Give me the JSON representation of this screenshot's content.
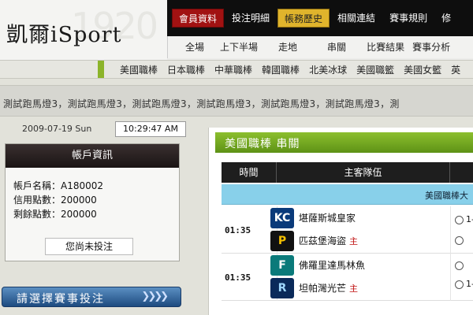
{
  "header": {
    "logo_text": "凱爾iSport",
    "logo_watermark": "1920"
  },
  "topnav": {
    "items": [
      {
        "label": "會員資料",
        "style": "red"
      },
      {
        "label": "投注明細",
        "style": "plain"
      },
      {
        "label": "帳務歷史",
        "style": "yellow"
      },
      {
        "label": "相關連結",
        "style": "plain"
      },
      {
        "label": "賽事規則",
        "style": "plain"
      },
      {
        "label": "修",
        "style": "plain"
      }
    ]
  },
  "subnav": {
    "items": [
      "全場",
      "上下半場",
      "走地",
      "串關",
      "比賽結果",
      "賽事分析"
    ]
  },
  "categories": {
    "items": [
      "美國職棒",
      "日本職棒",
      "中華職棒",
      "韓國職棒",
      "北美冰球",
      "美國職籃",
      "美國女籃",
      "英"
    ]
  },
  "marquee": {
    "text": "測試跑馬燈3，測試跑馬燈3，測試跑馬燈3，測試跑馬燈3，測試跑馬燈3，測試跑馬燈3，測"
  },
  "clock": {
    "date": "2009-07-19  Sun",
    "time": "10:29:47 AM"
  },
  "account": {
    "title": "帳戶資訊",
    "name_row": "帳戶名稱：A180002",
    "credit_row": "信用點數：200000",
    "balance_row": "剩餘點數：200000",
    "bet_status": "您尚未投注"
  },
  "choose_bar": {
    "label": "請選擇賽事投注",
    "arrows": "❯❯❯❯"
  },
  "content": {
    "title": "美國職棒  串關",
    "col_time": "時間",
    "col_team": "主客隊伍",
    "league": "美國職棒大",
    "host_mark": "主",
    "matches": [
      {
        "time": "01:35",
        "away": {
          "name": "堪薩斯城皇家",
          "logo": "KC",
          "color": "#0a3a7a"
        },
        "home": {
          "name": "匹茲堡海盜",
          "logo": "P",
          "color": "#111111"
        },
        "odds_a": "1-"
      },
      {
        "time": "01:35",
        "away": {
          "name": "佛羅里達馬林魚",
          "logo": "F",
          "color": "#0a7a7a"
        },
        "home": {
          "name": "坦帕灣光芒",
          "logo": "R",
          "color": "#0a2a5a"
        },
        "odds_a": "1-"
      }
    ]
  },
  "colors": {
    "accent_green": "#6a9e1e",
    "topbar": "#0e0e0e",
    "league_bar": "#88d0ea"
  }
}
